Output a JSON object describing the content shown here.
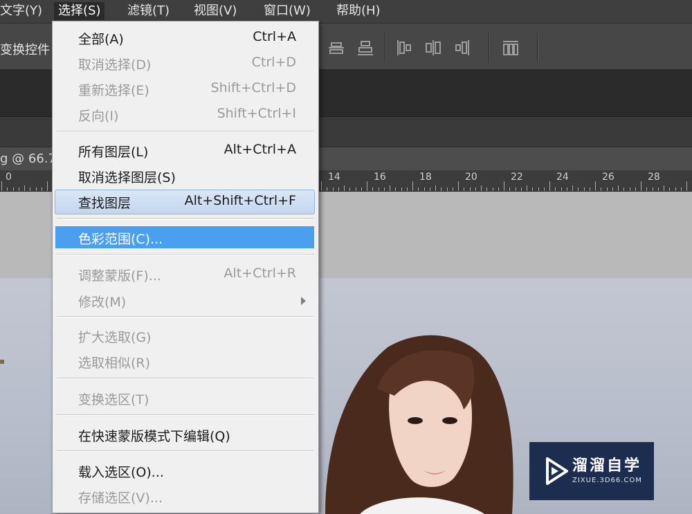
{
  "menubar": {
    "items": [
      {
        "label": "文字(Y)"
      },
      {
        "label": "选择(S)"
      },
      {
        "label": "滤镜(T)"
      },
      {
        "label": "视图(V)"
      },
      {
        "label": "窗口(W)"
      },
      {
        "label": "帮助(H)"
      }
    ]
  },
  "optionsbar": {
    "label": "变换控件"
  },
  "document": {
    "tab_title": "g @ 66.7"
  },
  "ruler": {
    "labels": [
      "0",
      "14",
      "16",
      "18",
      "20",
      "22",
      "24",
      "26",
      "28"
    ]
  },
  "select_menu": {
    "items": [
      {
        "label": "全部(A)",
        "shortcut": "Ctrl+A"
      },
      {
        "label": "取消选择(D)",
        "shortcut": "Ctrl+D"
      },
      {
        "label": "重新选择(E)",
        "shortcut": "Shift+Ctrl+D"
      },
      {
        "label": "反向(I)",
        "shortcut": "Shift+Ctrl+I"
      },
      {
        "label": "所有图层(L)",
        "shortcut": "Alt+Ctrl+A"
      },
      {
        "label": "取消选择图层(S)",
        "shortcut": ""
      },
      {
        "label": "查找图层",
        "shortcut": "Alt+Shift+Ctrl+F"
      },
      {
        "label": "色彩范围(C)...",
        "shortcut": ""
      },
      {
        "label": "调整蒙版(F)...",
        "shortcut": "Alt+Ctrl+R"
      },
      {
        "label": "修改(M)",
        "shortcut": ""
      },
      {
        "label": "扩大选取(G)",
        "shortcut": ""
      },
      {
        "label": "选取相似(R)",
        "shortcut": ""
      },
      {
        "label": "变换选区(T)",
        "shortcut": ""
      },
      {
        "label": "在快速蒙版模式下编辑(Q)",
        "shortcut": ""
      },
      {
        "label": "载入选区(O)...",
        "shortcut": ""
      },
      {
        "label": "存储选区(V)...",
        "shortcut": ""
      }
    ]
  },
  "watermark": {
    "brand": "溜溜自学",
    "site": "ZIXUE.3D66.COM"
  },
  "colors": {
    "menu_bg": "#f0f0f0",
    "selected_item": "#4aa0f0",
    "hover_item": "#c3d6ef",
    "disabled_text": "#9a9a9a",
    "watermark_bg": "#1d2d4f"
  }
}
